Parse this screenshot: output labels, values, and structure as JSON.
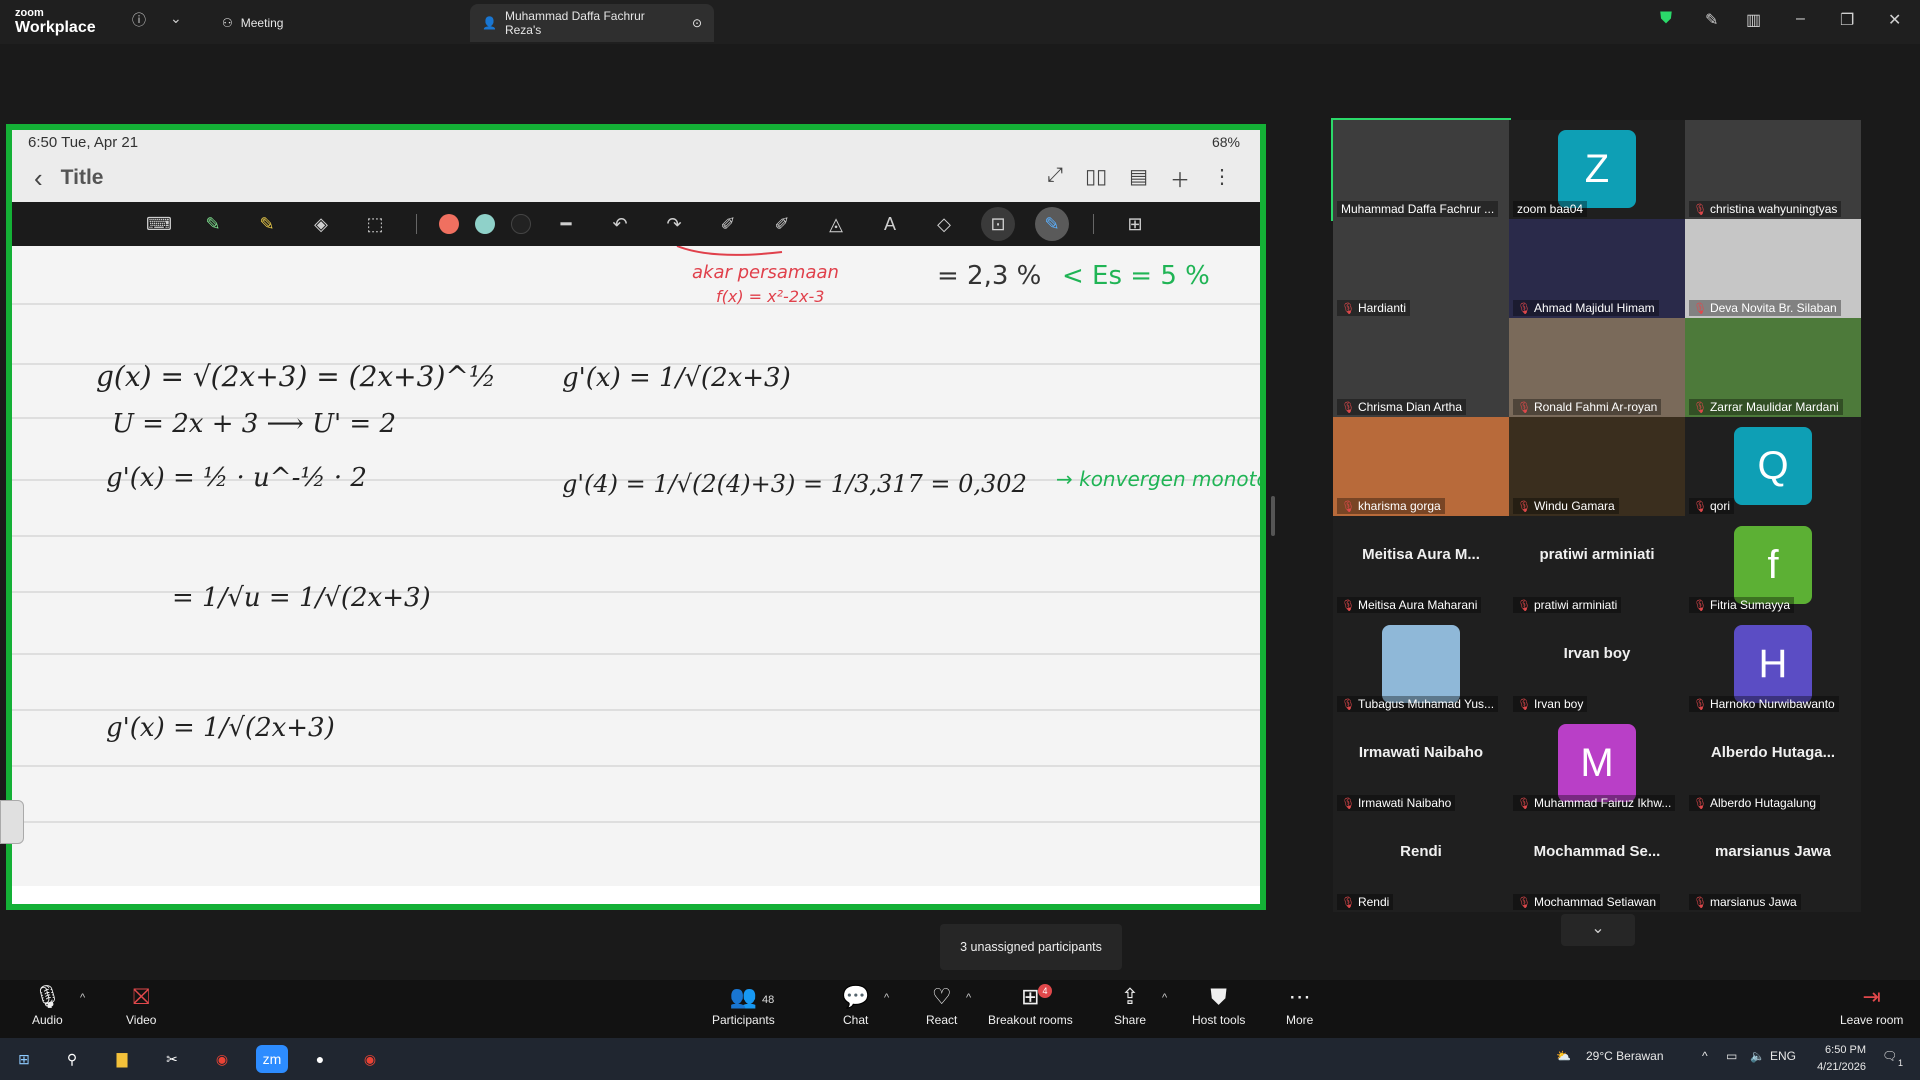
{
  "titlebar": {
    "logo_line1": "zoom",
    "logo_line2": "Workplace",
    "tab_meeting": "Meeting",
    "tab_share": "Muhammad Daffa Fachrur Reza's"
  },
  "shared": {
    "status_time": "6:50  Tue, Apr 21",
    "status_right": "68%",
    "note_title": "Title",
    "colors": [
      "#f07060",
      "#8fd1c9",
      "#222222"
    ],
    "math": {
      "top_annot_1": "akar persamaan",
      "top_annot_2": "f(x) = x²-2x-3",
      "top_eq": "= 2,3 %",
      "top_es": "< Es = 5 %",
      "eq1": "g(x) = √(2x+3) = (2x+3)^½",
      "eq2": "U = 2x + 3  ⟶  U' = 2",
      "eq3": "g'(x) = ½ · u^-½ · 2",
      "eq4": "= 1/√u = 1/√(2x+3)",
      "eq5": "g'(x) = 1/√(2x+3)",
      "eq6": "g'(x) = 1/√(2x+3)",
      "eq7": "g'(4) = 1/√(2(4)+3) = 1/3,317 = 0,302",
      "eq7_annot": "→ konvergen monoton"
    }
  },
  "participants": [
    {
      "name": "Muhammad Daffa Fachrur ...",
      "type": "video",
      "muted": false,
      "active": true
    },
    {
      "name": "zoom baa04",
      "type": "avatar",
      "letter": "Z",
      "color": "#0e9fb5",
      "muted": false
    },
    {
      "name": "christina wahyuningtyas",
      "type": "video",
      "muted": true
    },
    {
      "name": "Hardianti",
      "type": "video",
      "muted": true
    },
    {
      "name": "Ahmad Majidul Himam",
      "type": "video",
      "muted": true
    },
    {
      "name": "Deva Novita Br. Silaban",
      "type": "video",
      "muted": true
    },
    {
      "name": "Chrisma Dian Artha",
      "type": "video",
      "muted": true
    },
    {
      "name": "Ronald Fahmi Ar-royan",
      "type": "video",
      "muted": true
    },
    {
      "name": "Zarrar Maulidar Mardani",
      "type": "video",
      "muted": true
    },
    {
      "name": "kharisma gorga",
      "type": "video",
      "muted": true
    },
    {
      "name": "Windu Gamara",
      "type": "video",
      "muted": true
    },
    {
      "name": "qori",
      "type": "avatar",
      "letter": "Q",
      "color": "#0e9fb5",
      "muted": true
    },
    {
      "name": "Meitisa Aura Maharani",
      "type": "text",
      "big": "Meitisa  Aura  M...",
      "muted": true
    },
    {
      "name": "pratiwi arminiati",
      "type": "text",
      "big": "pratiwi arminiati",
      "muted": true
    },
    {
      "name": "Fitria Sumayya",
      "type": "avatar",
      "letter": "f",
      "color": "#5cb034",
      "muted": true
    },
    {
      "name": "Tubagus Muhamad Yus...",
      "type": "photo",
      "muted": true
    },
    {
      "name": "Irvan boy",
      "type": "text",
      "big": "Irvan boy",
      "muted": true
    },
    {
      "name": "Harnoko Nurwibawanto",
      "type": "avatar",
      "letter": "H",
      "color": "#5b4dc4",
      "muted": true
    },
    {
      "name": "Irmawati Naibaho",
      "type": "text",
      "big": "Irmawati Naibaho",
      "muted": true
    },
    {
      "name": "Muhammad Fairuz Ikhw...",
      "type": "avatar",
      "letter": "M",
      "color": "#b93fc7",
      "muted": true
    },
    {
      "name": "Alberdo Hutagalung",
      "type": "text",
      "big": "Alberdo  Hutaga...",
      "muted": true
    },
    {
      "name": "Rendi",
      "type": "text",
      "big": "Rendi",
      "muted": true
    },
    {
      "name": "Mochammad Setiawan",
      "type": "text",
      "big": "Mochammad  Se...",
      "muted": true
    },
    {
      "name": "marsianus Jawa",
      "type": "text",
      "big": "marsianus Jawa",
      "muted": true
    }
  ],
  "toast": "3 unassigned participants",
  "controls": {
    "audio": "Audio",
    "video": "Video",
    "participants": "Participants",
    "participants_count": "48",
    "chat": "Chat",
    "react": "React",
    "breakout": "Breakout rooms",
    "breakout_badge": "4",
    "share": "Share",
    "host_tools": "Host tools",
    "more": "More",
    "leave": "Leave room"
  },
  "taskbar": {
    "weather": "29°C  Berawan",
    "lang": "ENG",
    "time": "6:50 PM",
    "date": "4/21/2026",
    "notif": "1"
  }
}
